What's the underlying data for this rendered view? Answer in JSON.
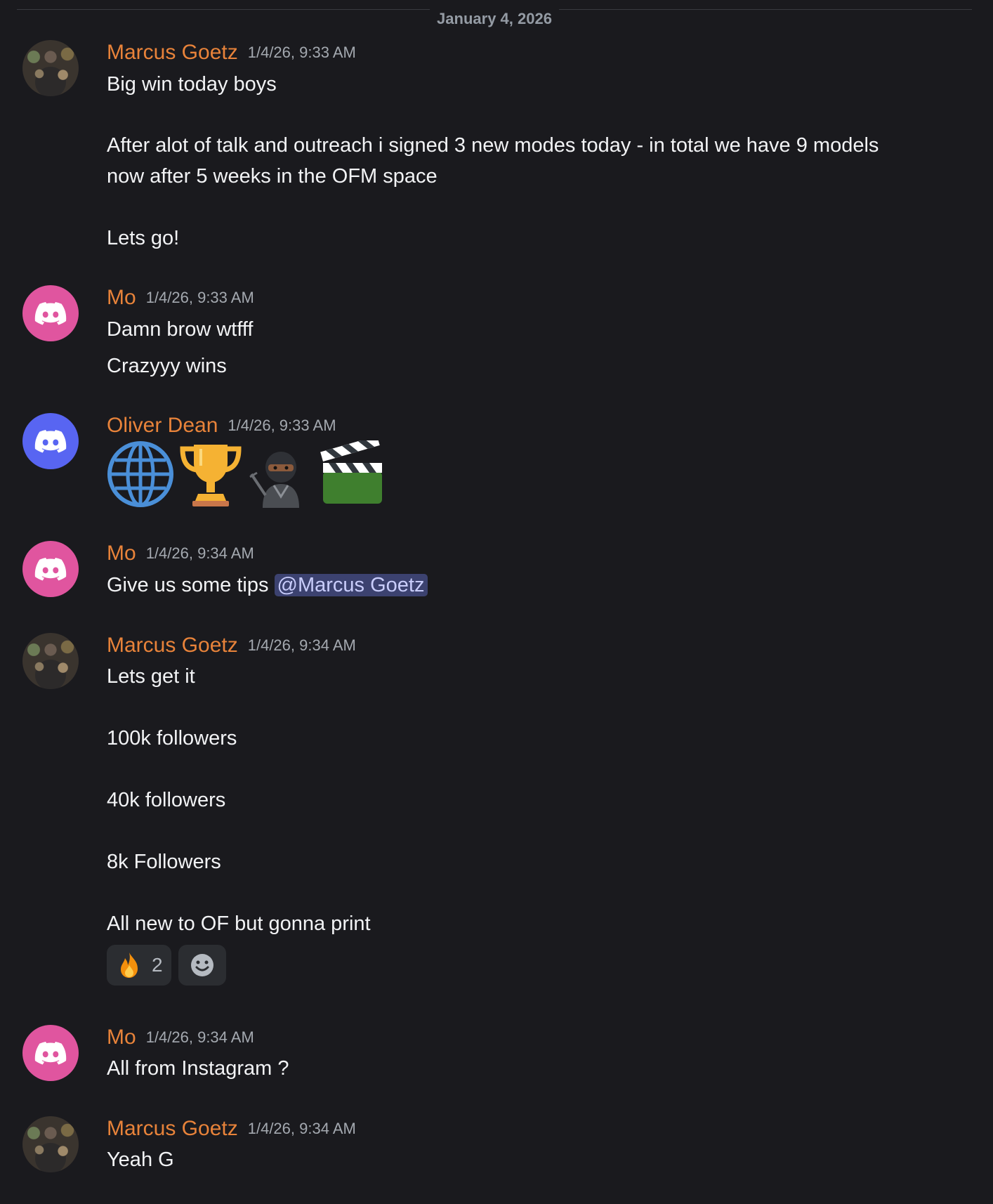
{
  "date_divider": "January 4, 2026",
  "colors": {
    "background": "#1a1a1e",
    "username": "#e8833a",
    "timestamp": "#a4a9b0",
    "mention_bg": "#3c4270",
    "mo_avatar": "#e0559f",
    "oliver_avatar": "#5865f2"
  },
  "messages": [
    {
      "author": "Marcus Goetz",
      "timestamp": "1/4/26, 9:33 AM",
      "avatar": "photo-avatar",
      "lines": [
        "Big win today boys",
        "After alot of talk and outreach i signed 3 new modes today - in total we have 9 models",
        "now after 5 weeks in the OFM space",
        "Lets go!"
      ]
    },
    {
      "author": "Mo",
      "timestamp": "1/4/26, 9:33 AM",
      "avatar": "discord-icon",
      "lines": [
        "Damn brow wtfff",
        "Crazyyy wins"
      ]
    },
    {
      "author": "Oliver Dean",
      "timestamp": "1/4/26, 9:33 AM",
      "avatar": "discord-icon",
      "emojis": [
        "globe-icon",
        "trophy-icon",
        "ninja-icon",
        "clapperboard-icon"
      ]
    },
    {
      "author": "Mo",
      "timestamp": "1/4/26, 9:34 AM",
      "avatar": "discord-icon",
      "text": "Give us some tips",
      "mention": "@Marcus Goetz"
    },
    {
      "author": "Marcus Goetz",
      "timestamp": "1/4/26, 9:34 AM",
      "avatar": "photo-avatar",
      "lines": [
        "Lets get it",
        "100k followers",
        "40k followers",
        "8k Followers",
        "All new to OF but gonna print"
      ],
      "reactions": [
        {
          "emoji": "fire-icon",
          "count": "2"
        },
        {
          "emoji": "add-reaction-icon"
        }
      ]
    },
    {
      "author": "Mo",
      "timestamp": "1/4/26, 9:34 AM",
      "avatar": "discord-icon",
      "lines": [
        "All from Instagram ?"
      ]
    },
    {
      "author": "Marcus Goetz",
      "timestamp": "1/4/26, 9:34 AM",
      "avatar": "photo-avatar",
      "lines": [
        "Yeah G"
      ]
    }
  ]
}
